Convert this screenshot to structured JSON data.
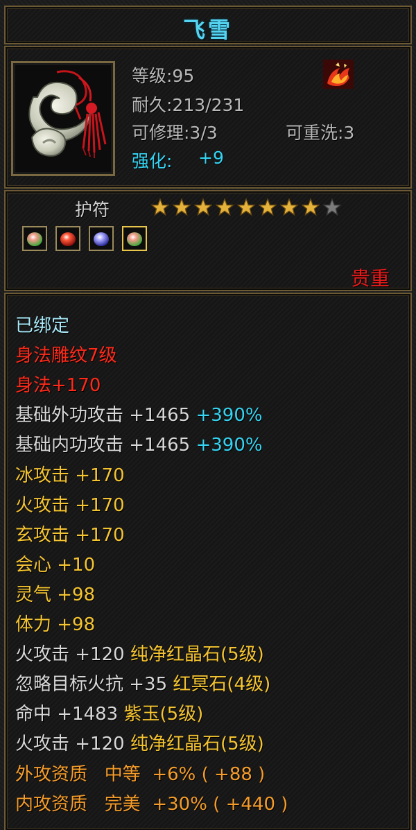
{
  "item": {
    "name": "飞雪",
    "icon": "jade-pendant-icon",
    "category": "护符",
    "quality": "贵重",
    "stats": {
      "level": "等级:95",
      "durability": "耐久:213/231",
      "repair": "可修理:3/3",
      "rewash": "可重洗:3",
      "enhance_label": "强化:",
      "enhance_value": "+9"
    },
    "stars": {
      "filled": 8,
      "total": 9
    },
    "gem_slots": [
      {
        "icon": "green-gem-icon",
        "selected": false
      },
      {
        "icon": "red-gem-icon",
        "selected": false
      },
      {
        "icon": "blue-gem-icon",
        "selected": false
      },
      {
        "icon": "green-gem-icon",
        "selected": true
      }
    ],
    "effect_icon": "fire-phoenix-icon"
  },
  "colors": {
    "white": "#d8d8d8",
    "light_cyan": "#a8e8f8",
    "cyan": "#35d4f2",
    "red": "#ff2a1a",
    "yellow": "#f5c431",
    "orange": "#f59c2a",
    "gray": "#b9b9b9"
  },
  "attributes": [
    [
      {
        "t": "已绑定",
        "c": "light_cyan"
      }
    ],
    [
      {
        "t": "身法雕纹7级",
        "c": "red"
      }
    ],
    [
      {
        "t": "身法+170",
        "c": "red"
      }
    ],
    [
      {
        "t": "基础外功攻击 +1465 ",
        "c": "white"
      },
      {
        "t": "+390%",
        "c": "cyan"
      }
    ],
    [
      {
        "t": "基础内功攻击 +1465 ",
        "c": "white"
      },
      {
        "t": "+390%",
        "c": "cyan"
      }
    ],
    [
      {
        "t": "冰攻击 +170",
        "c": "yellow"
      }
    ],
    [
      {
        "t": "火攻击 +170",
        "c": "yellow"
      }
    ],
    [
      {
        "t": "玄攻击 +170",
        "c": "yellow"
      }
    ],
    [
      {
        "t": "会心 +10",
        "c": "yellow"
      }
    ],
    [
      {
        "t": "灵气 +98",
        "c": "yellow"
      }
    ],
    [
      {
        "t": "体力 +98",
        "c": "yellow"
      }
    ],
    [
      {
        "t": "火攻击 +120 ",
        "c": "white"
      },
      {
        "t": "纯净红晶石(5级)",
        "c": "yellow"
      }
    ],
    [
      {
        "t": "忽略目标火抗 +35 ",
        "c": "white"
      },
      {
        "t": "红冥石(4级)",
        "c": "yellow"
      }
    ],
    [
      {
        "t": "命中 +1483 ",
        "c": "white"
      },
      {
        "t": "紫玉(5级)",
        "c": "yellow"
      }
    ],
    [
      {
        "t": "火攻击 +120 ",
        "c": "white"
      },
      {
        "t": "纯净红晶石(5级)",
        "c": "yellow"
      }
    ],
    [
      {
        "t": "外攻资质   中等  +6% ( +88 )",
        "c": "orange"
      }
    ],
    [
      {
        "t": "内攻资质   完美  +30% ( +440 )",
        "c": "orange"
      }
    ]
  ]
}
